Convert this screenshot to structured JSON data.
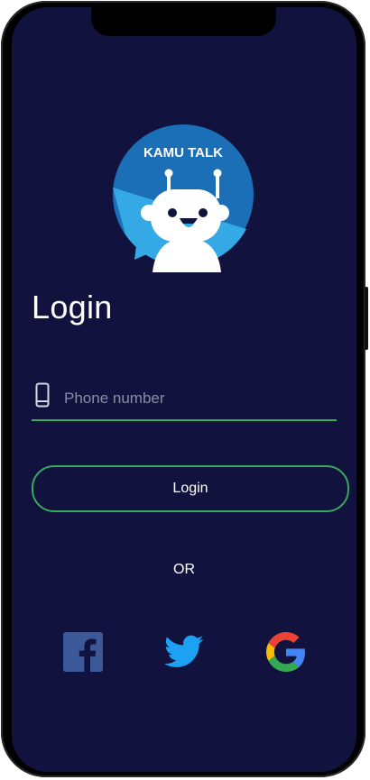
{
  "app": {
    "brand_text": "KAMU TALK"
  },
  "login": {
    "title": "Login",
    "phone_placeholder": "Phone number",
    "button_label": "Login",
    "divider_text": "OR"
  },
  "social": [
    {
      "name": "facebook",
      "icon": "facebook-icon"
    },
    {
      "name": "twitter",
      "icon": "twitter-icon"
    },
    {
      "name": "google",
      "icon": "google-icon"
    }
  ],
  "colors": {
    "background": "#12123f",
    "accent_green": "#3aa85f",
    "logo_blue": "#1b6fb6",
    "logo_light_blue": "#35a9e6",
    "facebook": "#3b5998",
    "twitter": "#1da1f2"
  }
}
